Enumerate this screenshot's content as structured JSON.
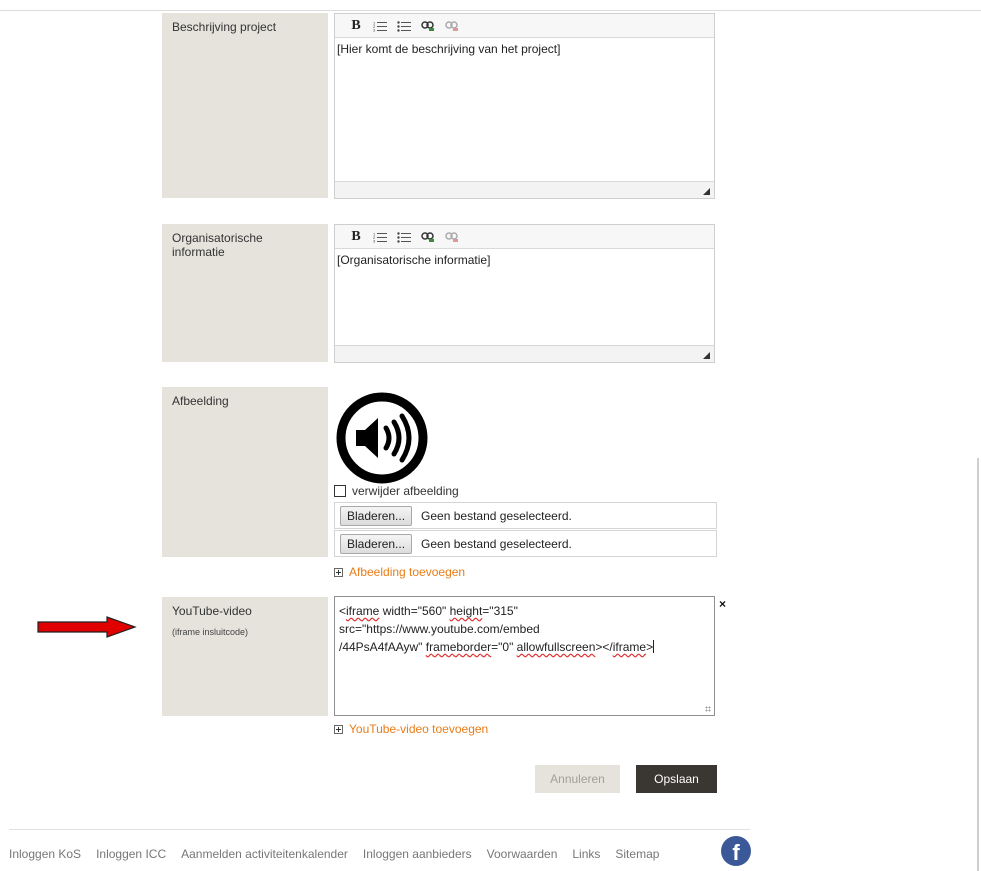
{
  "toolbar_icons": [
    "bold-icon",
    "numbered-list-icon",
    "bullet-list-icon",
    "link-icon",
    "unlink-icon"
  ],
  "toolbar_labels": {
    "bold": "B"
  },
  "fields": {
    "description": {
      "label": "Beschrijving project",
      "content": "[Hier komt de beschrijving van het project]"
    },
    "organisation": {
      "label": "Organisatorische informatie",
      "content": "[Organisatorische informatie]"
    },
    "image": {
      "label": "Afbeelding",
      "remove_label": "verwijder afbeelding",
      "browse_label": "Bladeren...",
      "no_file_label": "Geen bestand geselecteerd.",
      "add_label": "Afbeelding toevoegen"
    },
    "youtube": {
      "label": "YouTube-video",
      "sublabel": "(iframe insluitcode)",
      "code_part1": "<",
      "code_w1": "iframe",
      "code_part2": " width=\"560\" ",
      "code_w2": "height",
      "code_part3": "=\"315\" src=\"https://www.youtube.com/embed",
      "code_part4": "/44PsA4fAAyw\" ",
      "code_w3": "frameborder",
      "code_part5": "=\"0\" ",
      "code_w4": "allowfullscreen",
      "code_part6": "></",
      "code_w5": "iframe",
      "code_part7": ">",
      "close_label": "×",
      "add_label": "YouTube-video toevoegen"
    }
  },
  "actions": {
    "cancel": "Annuleren",
    "save": "Opslaan"
  },
  "footer": {
    "links": [
      "Inloggen KoS",
      "Inloggen ICC",
      "Aanmelden activiteitenkalender",
      "Inloggen aanbieders",
      "Voorwaarden",
      "Links",
      "Sitemap"
    ],
    "facebook_glyph": "f"
  },
  "colors": {
    "label_bg": "#e5e3dc",
    "link_orange": "#e87c18",
    "save_bg": "#3a3632",
    "arrow_red": "#e00000",
    "facebook_blue": "#3b5998"
  }
}
